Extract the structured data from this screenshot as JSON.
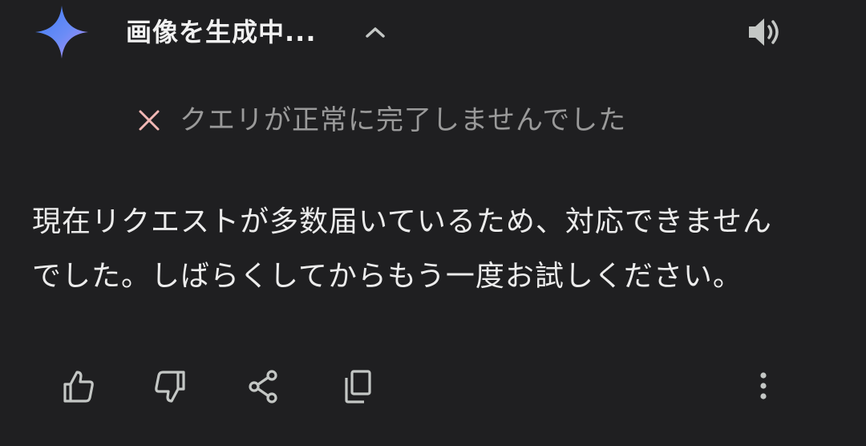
{
  "header": {
    "title": "画像を生成中...",
    "logo_icon": "gemini-sparkle-icon",
    "expand_icon": "chevron-up-icon",
    "speaker_icon": "speaker-icon"
  },
  "error": {
    "icon": "close-icon",
    "message": "クエリが正常に完了しませんでした",
    "icon_color": "#f2b8b5"
  },
  "response": {
    "lines": [
      "現在リクエストが多数届いているため、対応できません",
      "でした。しばらくしてからもう一度お試しください。"
    ]
  },
  "actions": {
    "items": [
      {
        "name": "thumbs-up",
        "icon": "thumbs-up-icon"
      },
      {
        "name": "thumbs-down",
        "icon": "thumbs-down-icon"
      },
      {
        "name": "share",
        "icon": "share-icon"
      },
      {
        "name": "copy",
        "icon": "copy-icon"
      },
      {
        "name": "more",
        "icon": "more-vertical-icon"
      }
    ]
  },
  "colors": {
    "background": "#1f1f21",
    "text": "#ececec",
    "muted_text": "#9a9a9a",
    "icon": "#c4c7c5",
    "logo_gradient": [
      "#4f8cf7",
      "#8a7cf0",
      "#c58af5"
    ]
  }
}
